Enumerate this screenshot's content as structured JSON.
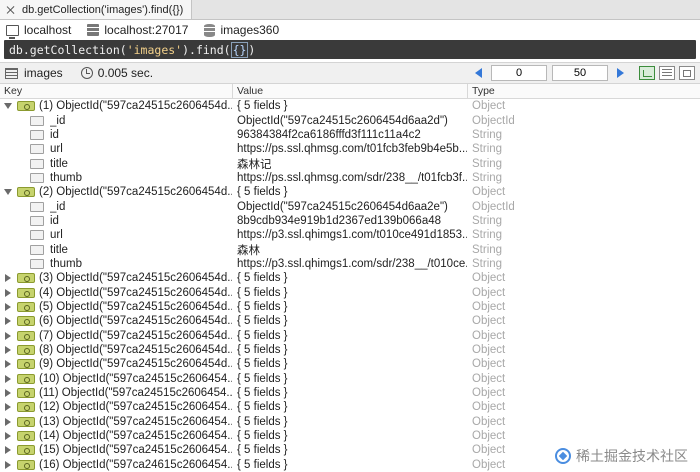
{
  "tab": {
    "title": "db.getCollection('images').find({})"
  },
  "connection": {
    "name": "localhost",
    "server": "localhost:27017",
    "database": "images360"
  },
  "query": {
    "prefix": "db.getCollection(",
    "string": "'images'",
    "middle": ").find(",
    "arg": "{}",
    "suffix": ")"
  },
  "result": {
    "collection": "images",
    "time": "0.005 sec.",
    "skip": "0",
    "limit": "50"
  },
  "columns": {
    "key": "Key",
    "value": "Value",
    "type": "Type"
  },
  "documents": [
    {
      "key": "(1) ObjectId(\"597ca24515c2606454d...",
      "value": "{ 5 fields }",
      "type": "Object",
      "expanded": true,
      "fields": [
        {
          "key": "_id",
          "value": "ObjectId(\"597ca24515c2606454d6aa2d\")",
          "type": "ObjectId"
        },
        {
          "key": "id",
          "value": "96384384f2ca6186fffd3f111c11a4c2",
          "type": "String"
        },
        {
          "key": "url",
          "value": "https://ps.ssl.qhmsg.com/t01fcb3feb9b4e5b...",
          "type": "String"
        },
        {
          "key": "title",
          "value": "森林记",
          "type": "String"
        },
        {
          "key": "thumb",
          "value": "https://ps.ssl.qhmsg.com/sdr/238__/t01fcb3f...",
          "type": "String"
        }
      ]
    },
    {
      "key": "(2) ObjectId(\"597ca24515c2606454d...",
      "value": "{ 5 fields }",
      "type": "Object",
      "expanded": true,
      "fields": [
        {
          "key": "_id",
          "value": "ObjectId(\"597ca24515c2606454d6aa2e\")",
          "type": "ObjectId"
        },
        {
          "key": "id",
          "value": "8b9cdb934e919b1d2367ed139b066a48",
          "type": "String"
        },
        {
          "key": "url",
          "value": "https://p3.ssl.qhimgs1.com/t010ce491d1853...",
          "type": "String"
        },
        {
          "key": "title",
          "value": "森林",
          "type": "String"
        },
        {
          "key": "thumb",
          "value": "https://p3.ssl.qhimgs1.com/sdr/238__/t010ce...",
          "type": "String"
        }
      ]
    },
    {
      "key": "(3) ObjectId(\"597ca24515c2606454d...",
      "value": "{ 5 fields }",
      "type": "Object",
      "expanded": false
    },
    {
      "key": "(4) ObjectId(\"597ca24515c2606454d...",
      "value": "{ 5 fields }",
      "type": "Object",
      "expanded": false
    },
    {
      "key": "(5) ObjectId(\"597ca24515c2606454d...",
      "value": "{ 5 fields }",
      "type": "Object",
      "expanded": false
    },
    {
      "key": "(6) ObjectId(\"597ca24515c2606454d...",
      "value": "{ 5 fields }",
      "type": "Object",
      "expanded": false
    },
    {
      "key": "(7) ObjectId(\"597ca24515c2606454d...",
      "value": "{ 5 fields }",
      "type": "Object",
      "expanded": false
    },
    {
      "key": "(8) ObjectId(\"597ca24515c2606454d...",
      "value": "{ 5 fields }",
      "type": "Object",
      "expanded": false
    },
    {
      "key": "(9) ObjectId(\"597ca24515c2606454d...",
      "value": "{ 5 fields }",
      "type": "Object",
      "expanded": false
    },
    {
      "key": "(10) ObjectId(\"597ca24515c2606454...",
      "value": "{ 5 fields }",
      "type": "Object",
      "expanded": false
    },
    {
      "key": "(11) ObjectId(\"597ca24515c2606454...",
      "value": "{ 5 fields }",
      "type": "Object",
      "expanded": false
    },
    {
      "key": "(12) ObjectId(\"597ca24515c2606454...",
      "value": "{ 5 fields }",
      "type": "Object",
      "expanded": false
    },
    {
      "key": "(13) ObjectId(\"597ca24515c2606454...",
      "value": "{ 5 fields }",
      "type": "Object",
      "expanded": false
    },
    {
      "key": "(14) ObjectId(\"597ca24515c2606454...",
      "value": "{ 5 fields }",
      "type": "Object",
      "expanded": false
    },
    {
      "key": "(15) ObjectId(\"597ca24515c2606454...",
      "value": "{ 5 fields }",
      "type": "Object",
      "expanded": false
    },
    {
      "key": "(16) ObjectId(\"597ca24615c2606454...",
      "value": "{ 5 fields }",
      "type": "Object",
      "expanded": false
    }
  ],
  "watermark": {
    "text": "稀土掘金技术社区"
  },
  "icons": {
    "tab_close": "close-icon",
    "connection": "monitor-icon",
    "server": "server-icon",
    "database": "database-icon",
    "collection": "table-icon",
    "time": "clock-icon",
    "prev": "arrow-left-icon",
    "next": "arrow-right-icon"
  },
  "colors": {
    "query_bg": "#3a3a3a",
    "pager_arrow": "#3478d8",
    "object_icon": "#c6d36d",
    "type_text": "#a8a8a8"
  }
}
